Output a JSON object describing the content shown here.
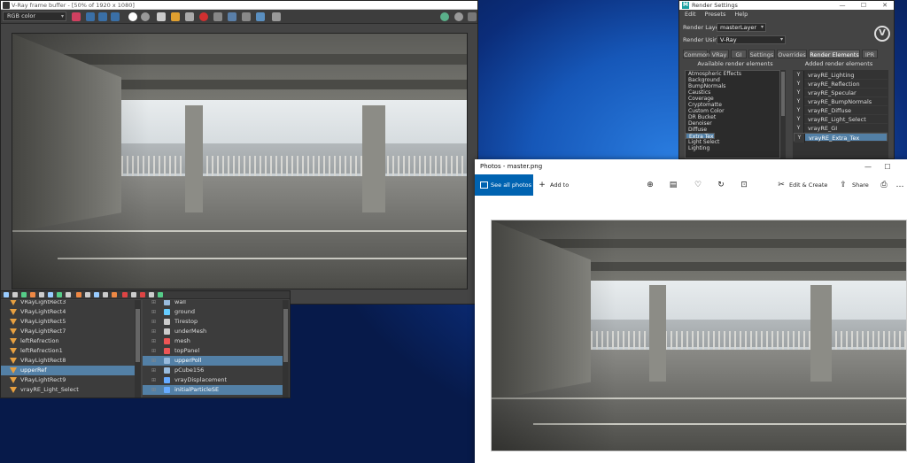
{
  "vfb": {
    "title": "V-Ray frame buffer - [50% of 1920 x 1080]",
    "channel": "RGB color"
  },
  "outliner": {
    "left_items": [
      {
        "label": "VRayLightRect3",
        "selected": false
      },
      {
        "label": "VRayLightRect4",
        "selected": false
      },
      {
        "label": "VRayLightRect5",
        "selected": false
      },
      {
        "label": "VRayLightRect7",
        "selected": false
      },
      {
        "label": "leftRefrection",
        "selected": false
      },
      {
        "label": "leftRefrection1",
        "selected": false
      },
      {
        "label": "VRayLightRect8",
        "selected": false
      },
      {
        "label": "upperRef",
        "selected": true
      },
      {
        "label": "VRayLightRect9",
        "selected": false
      },
      {
        "label": "vrayRE_Light_Select",
        "selected": false
      }
    ],
    "right_items": [
      {
        "label": "wall",
        "selected": false
      },
      {
        "label": "ground",
        "selected": false
      },
      {
        "label": "Tirestop",
        "selected": false
      },
      {
        "label": "underMesh",
        "selected": false
      },
      {
        "label": "mesh",
        "selected": false
      },
      {
        "label": "topPanel",
        "selected": false
      },
      {
        "label": "upperPoll",
        "selected": true
      },
      {
        "label": "pCube156",
        "selected": false
      },
      {
        "label": "vrayDisplacement",
        "selected": false
      },
      {
        "label": "initialParticleSE",
        "selected": true
      }
    ]
  },
  "render_settings": {
    "title": "Render Settings",
    "menu": [
      "Edit",
      "Presets",
      "Help"
    ],
    "render_layer_label": "Render Layer",
    "render_layer_value": "masterLayer",
    "render_using_label": "Render Using",
    "render_using_value": "V-Ray",
    "tabs": [
      {
        "label": "Common",
        "active": false
      },
      {
        "label": "VRay",
        "active": false
      },
      {
        "label": "GI",
        "active": false
      },
      {
        "label": "Settings",
        "active": false
      },
      {
        "label": "Overrides",
        "active": false
      },
      {
        "label": "Render Elements",
        "active": true
      },
      {
        "label": "IPR",
        "active": false
      }
    ],
    "available_header": "Available render elements",
    "added_header": "Added render elements",
    "available": [
      {
        "label": "Atmospheric Effects",
        "selected": false
      },
      {
        "label": "Background",
        "selected": false
      },
      {
        "label": "BumpNormals",
        "selected": false
      },
      {
        "label": "Caustics",
        "selected": false
      },
      {
        "label": "Coverage",
        "selected": false
      },
      {
        "label": "Cryptomatte",
        "selected": false
      },
      {
        "label": "Custom Color",
        "selected": false
      },
      {
        "label": "DR Bucket",
        "selected": false
      },
      {
        "label": "Denoiser",
        "selected": false
      },
      {
        "label": "Diffuse",
        "selected": false
      },
      {
        "label": "Extra Tex",
        "selected": true
      },
      {
        "label": "GI",
        "selected": false
      },
      {
        "label": "Light Select",
        "selected": false
      },
      {
        "label": "Lighting",
        "selected": false
      }
    ],
    "added": [
      {
        "flag": "Y",
        "label": "vrayRE_Lighting",
        "selected": false
      },
      {
        "flag": "Y",
        "label": "vrayRE_Reflection",
        "selected": false
      },
      {
        "flag": "Y",
        "label": "vrayRE_Specular",
        "selected": false
      },
      {
        "flag": "Y",
        "label": "vrayRE_BumpNormals",
        "selected": false
      },
      {
        "flag": "Y",
        "label": "vrayRE_Diffuse",
        "selected": false
      },
      {
        "flag": "Y",
        "label": "vrayRE_Light_Select",
        "selected": false
      },
      {
        "flag": "Y",
        "label": "vrayRE_GI",
        "selected": false
      },
      {
        "flag": "Y",
        "label": "vrayRE_Extra_Tex",
        "selected": true
      }
    ]
  },
  "photos": {
    "title": "Photos - master.png",
    "see_all": "See all photos",
    "add_to": "Add to",
    "edit_create": "Edit & Create",
    "share": "Share"
  },
  "colors": {
    "maya_selection": "#5380a6",
    "photos_accent": "#0063b1",
    "desktop_blue": "#1657b8"
  }
}
